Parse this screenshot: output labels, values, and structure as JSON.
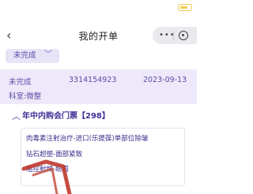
{
  "nav": {
    "title": "我的开单",
    "back_icon": "chevron-left-icon",
    "capsule": {
      "more_icon": "more-dots-icon",
      "close_icon": "target-icon"
    }
  },
  "filter": {
    "selected": "未完成",
    "chevron_icon": "chevron-down-icon"
  },
  "order": {
    "status": "未完成",
    "number": "3314154923",
    "date": "2023-09-13",
    "department": "科室:微整"
  },
  "package": {
    "title": "年中内购会门票【298】",
    "items": [
      "肉毒素注射治疗-进口(乐提葆)单部位除皱",
      "钻石超塑-面部紧致",
      "粗控射频-眼周"
    ]
  },
  "colors": {
    "accent": "#5b4ba6",
    "card_bg": "#eee9fa",
    "chip_bg": "#e8e3f7",
    "overlay": "#c0392b",
    "battery": "#f2c94c"
  }
}
